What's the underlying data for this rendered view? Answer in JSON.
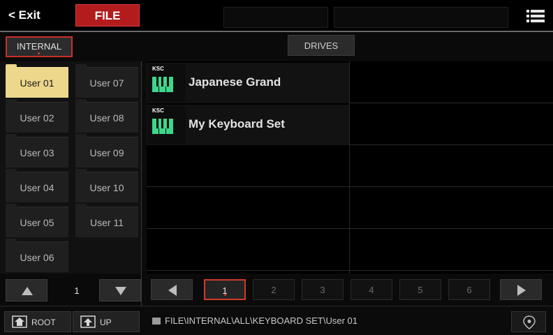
{
  "header": {
    "exit_label": "< Exit",
    "file_tab": "FILE",
    "menu_icon": "hamburger-menu-icon"
  },
  "source_bar": {
    "internal": "INTERNAL",
    "drives": "DRIVES"
  },
  "folders": [
    {
      "label": "User 01"
    },
    {
      "label": "User 07"
    },
    {
      "label": "User 02"
    },
    {
      "label": "User 08"
    },
    {
      "label": "User 03"
    },
    {
      "label": "User 09"
    },
    {
      "label": "User 04"
    },
    {
      "label": "User 10"
    },
    {
      "label": "User 05"
    },
    {
      "label": "User 11"
    },
    {
      "label": "User 06"
    }
  ],
  "folder_pager": {
    "page": "1"
  },
  "files": [
    {
      "type_label": "KSC",
      "name": "Japanese Grand"
    },
    {
      "type_label": "KSC",
      "name": "My Keyboard Set"
    }
  ],
  "file_pager": {
    "pages": [
      "1",
      "2",
      "3",
      "4",
      "5",
      "6"
    ],
    "active": "1"
  },
  "footer": {
    "root_label": "ROOT",
    "up_label": "UP",
    "path": "FILE\\INTERNAL\\ALL\\KEYBOARD SET\\User 01"
  },
  "colors": {
    "accent_red": "#b31c1c",
    "selected_folder": "#ecd78b",
    "ksc_green": "#3fd68b"
  }
}
